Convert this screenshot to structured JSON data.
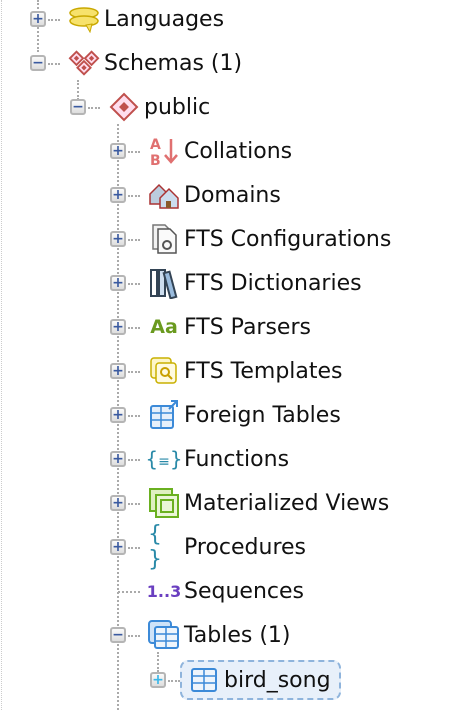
{
  "tree": {
    "languages": {
      "label": "Languages",
      "icon": "languages-icon",
      "state": "collapsed"
    },
    "schemas": {
      "label": "Schemas (1)",
      "icon": "schemas-icon",
      "state": "expanded"
    },
    "public": {
      "label": "public",
      "icon": "schema-icon",
      "state": "expanded"
    },
    "children": [
      {
        "label": "Collations",
        "icon": "collation-icon"
      },
      {
        "label": "Domains",
        "icon": "domain-icon"
      },
      {
        "label": "FTS Configurations",
        "icon": "fts-configuration-icon"
      },
      {
        "label": "FTS Dictionaries",
        "icon": "fts-dictionary-icon"
      },
      {
        "label": "FTS Parsers",
        "icon": "fts-parser-icon",
        "icon_text": "Aa"
      },
      {
        "label": "FTS Templates",
        "icon": "fts-template-icon"
      },
      {
        "label": "Foreign Tables",
        "icon": "foreign-table-icon"
      },
      {
        "label": "Functions",
        "icon": "function-icon"
      },
      {
        "label": "Materialized Views",
        "icon": "materialized-view-icon"
      },
      {
        "label": "Procedures",
        "icon": "procedure-icon"
      },
      {
        "label": "Sequences",
        "icon": "sequence-icon",
        "icon_text": "1..3"
      },
      {
        "label": "Tables (1)",
        "icon": "tables-icon"
      }
    ],
    "bird_song": {
      "label": "bird_song",
      "icon": "table-icon",
      "selected": true
    },
    "colors": {
      "selection_bg": "#e8f0fa",
      "selection_border": "#8fb4dc",
      "toggle_sign": "#3a5aa0"
    }
  }
}
